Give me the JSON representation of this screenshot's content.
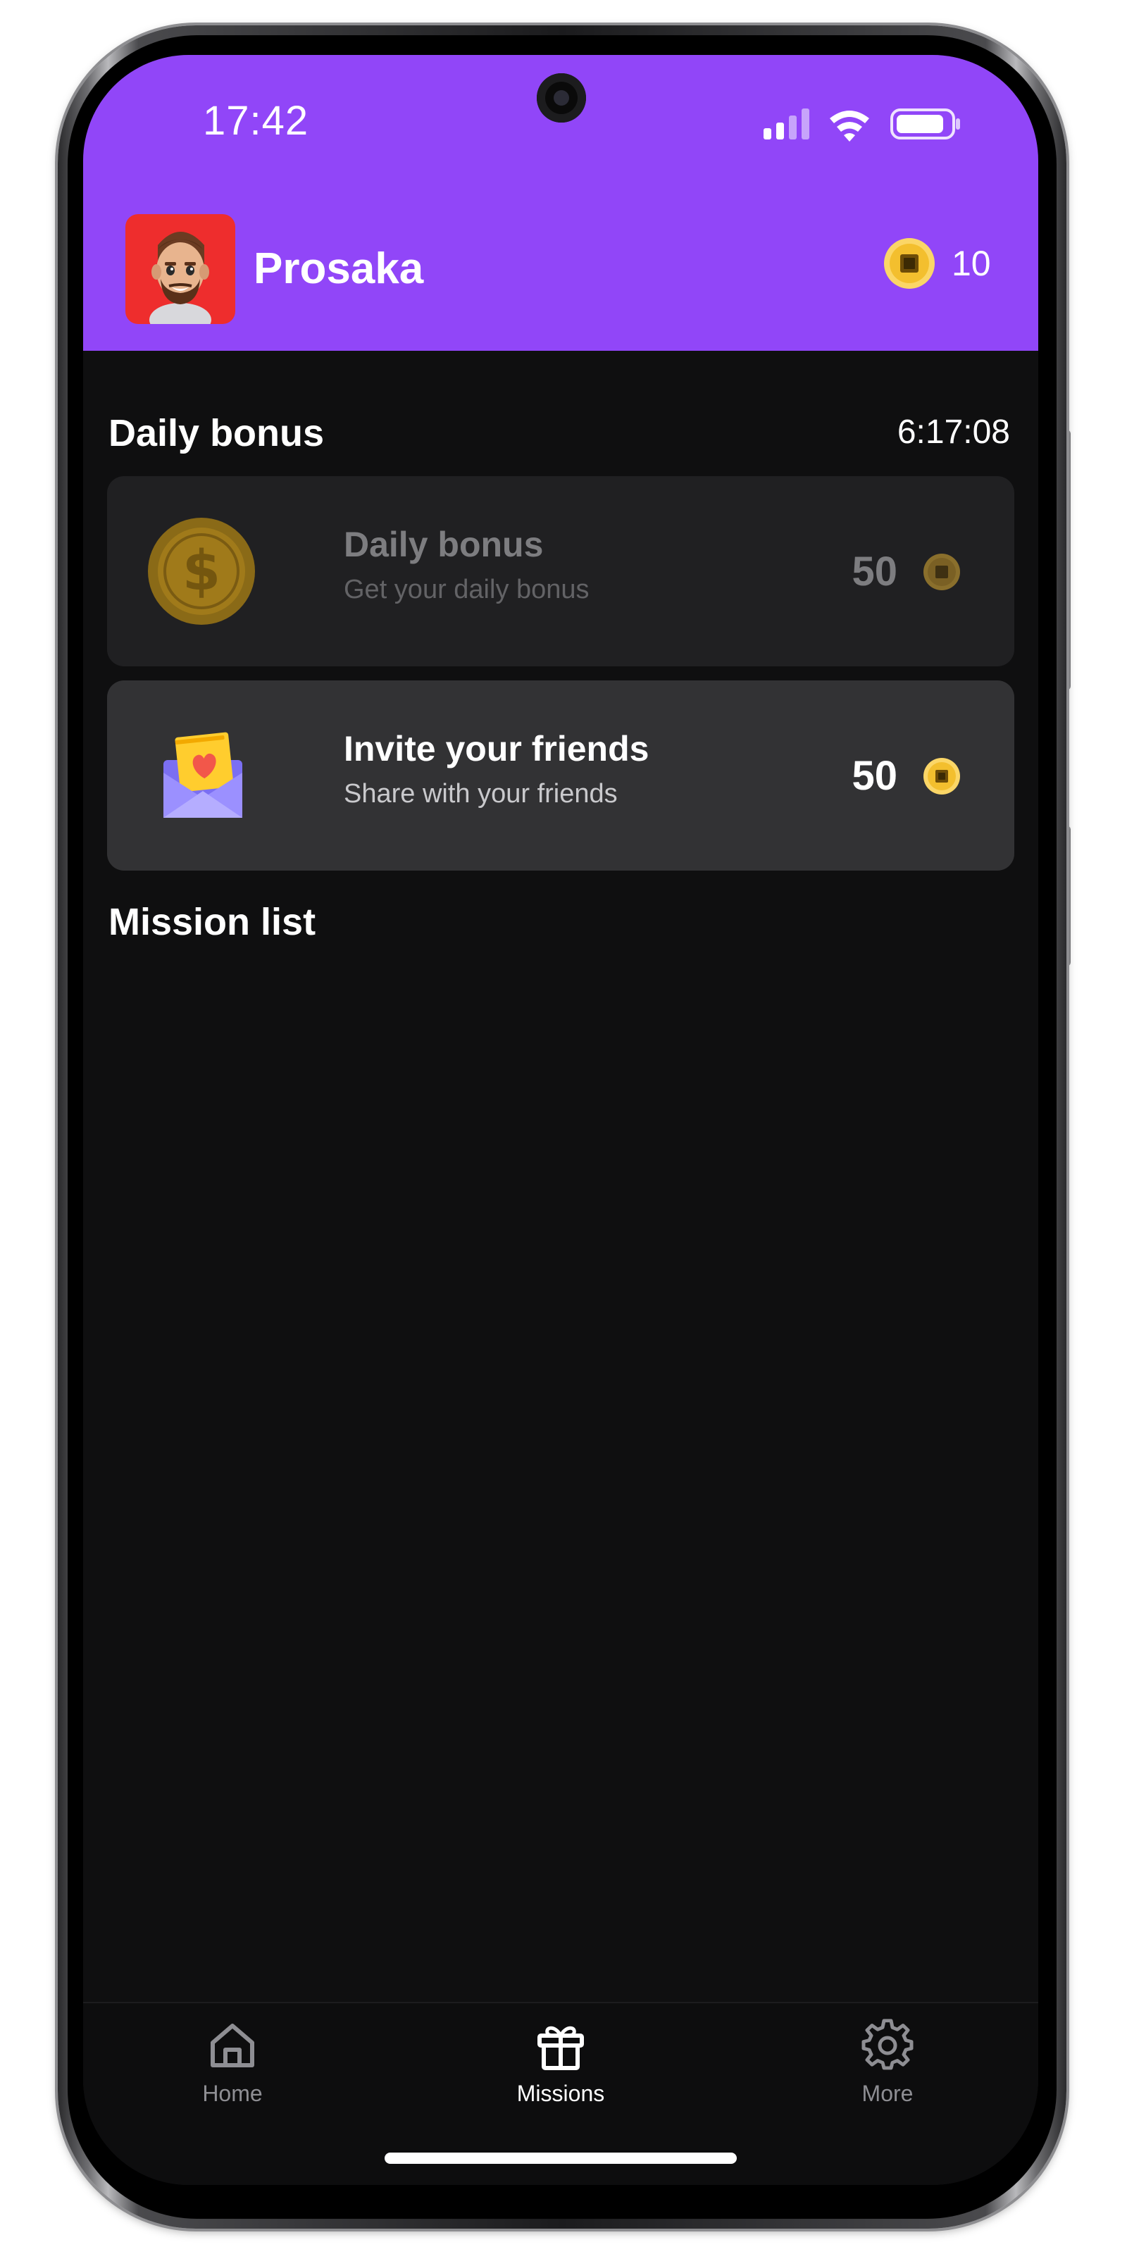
{
  "status_bar": {
    "time": "17:42"
  },
  "header": {
    "username": "Prosaka",
    "coin_balance": "10",
    "avatar_icon": "memoji-avatar-icon",
    "coin_icon": "coin-icon"
  },
  "daily_bonus": {
    "title": "Daily bonus",
    "timer": "6:17:08"
  },
  "cards": [
    {
      "title": "Daily bonus",
      "subtitle": "Get your daily bonus",
      "reward": "50",
      "icon": "dollar-coin-icon",
      "state": "disabled"
    },
    {
      "title": "Invite your friends",
      "subtitle": "Share with your friends",
      "reward": "50",
      "icon": "love-letter-icon",
      "state": "active"
    }
  ],
  "mission_list": {
    "title": "Mission list"
  },
  "nav": {
    "items": [
      {
        "label": "Home",
        "icon": "home-icon",
        "active": false
      },
      {
        "label": "Missions",
        "icon": "gift-icon",
        "active": true
      },
      {
        "label": "More",
        "icon": "gear-icon",
        "active": false
      }
    ]
  },
  "colors": {
    "header": "#9146f8",
    "background": "#0f0f10",
    "card_active": "#323234",
    "card_disabled": "#202022",
    "coin_gold": "#f6cc4a",
    "avatar_bg": "#ee2d2d"
  }
}
